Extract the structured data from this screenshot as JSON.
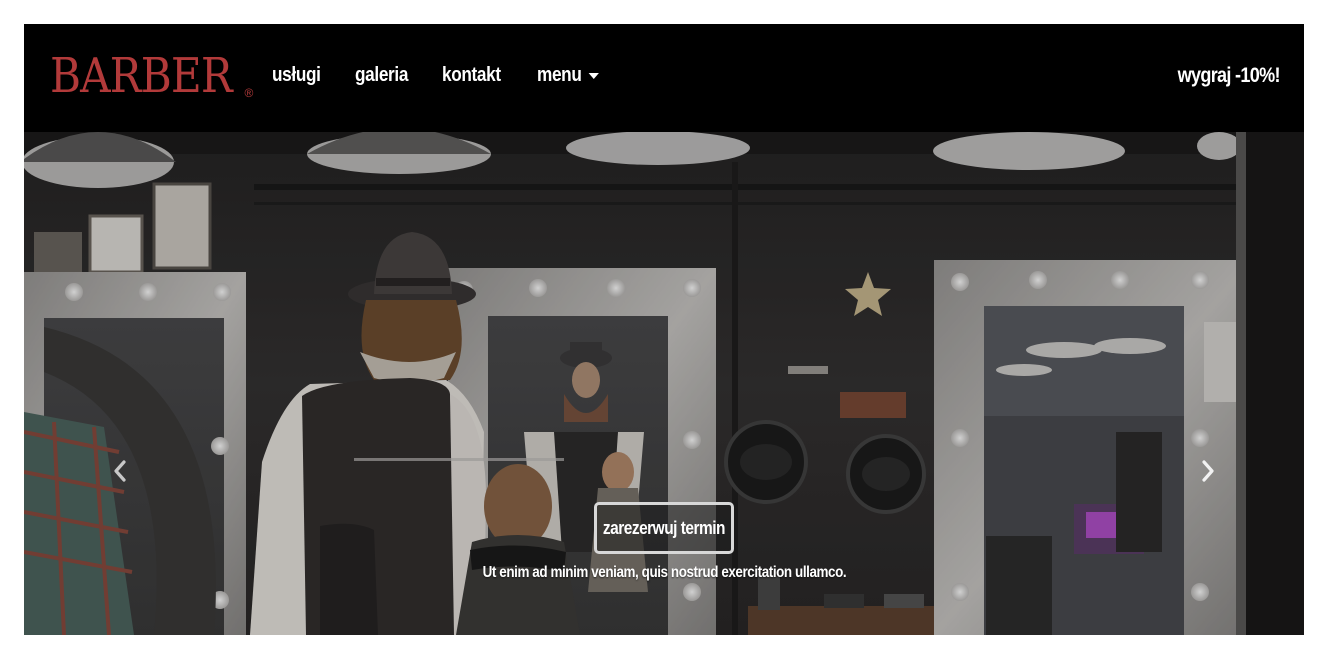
{
  "brand": {
    "name": "BARBER",
    "registered_mark": "®"
  },
  "nav": {
    "items": [
      {
        "label": "usługi"
      },
      {
        "label": "galeria"
      },
      {
        "label": "kontakt"
      },
      {
        "label": "menu",
        "has_dropdown": true
      }
    ],
    "promo": "wygraj -10%!"
  },
  "hero": {
    "cta_label": "zarezerwuj termin",
    "caption": "Ut enim ad minim veniam, quis nostrud exercitation ullamco.",
    "prev_icon": "chevron-left-icon",
    "next_icon": "chevron-right-icon"
  },
  "colors": {
    "brand": "#b23a3a",
    "navbar_bg": "#000000",
    "nav_text": "#ffffff"
  }
}
